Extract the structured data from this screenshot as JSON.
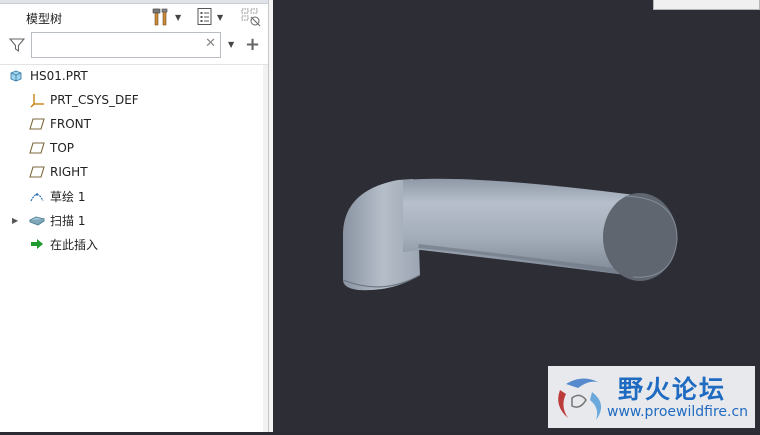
{
  "panel": {
    "title": "模型树",
    "search": {
      "value": "",
      "placeholder": ""
    },
    "tools_icon": "hammer-icon",
    "settings_icon": "tree-settings-icon",
    "columns_icon": "show-columns-icon"
  },
  "tree": {
    "items": [
      {
        "label": "HS01.PRT",
        "icon": "part-icon"
      },
      {
        "label": "PRT_CSYS_DEF",
        "icon": "csys-icon"
      },
      {
        "label": "FRONT",
        "icon": "datum-plane-icon"
      },
      {
        "label": "TOP",
        "icon": "datum-plane-icon"
      },
      {
        "label": "RIGHT",
        "icon": "datum-plane-icon"
      },
      {
        "label": "草绘 1",
        "icon": "sketch-icon"
      },
      {
        "label": "扫描 1",
        "icon": "sweep-icon",
        "expandable": true
      },
      {
        "label": "在此插入",
        "icon": "insert-arrow-icon"
      }
    ]
  },
  "viewport": {
    "background": "#2d2d35",
    "model_color": "#a7b0bd"
  },
  "watermark": {
    "name": "野火论坛",
    "url": "www.proewildfire.cn"
  }
}
